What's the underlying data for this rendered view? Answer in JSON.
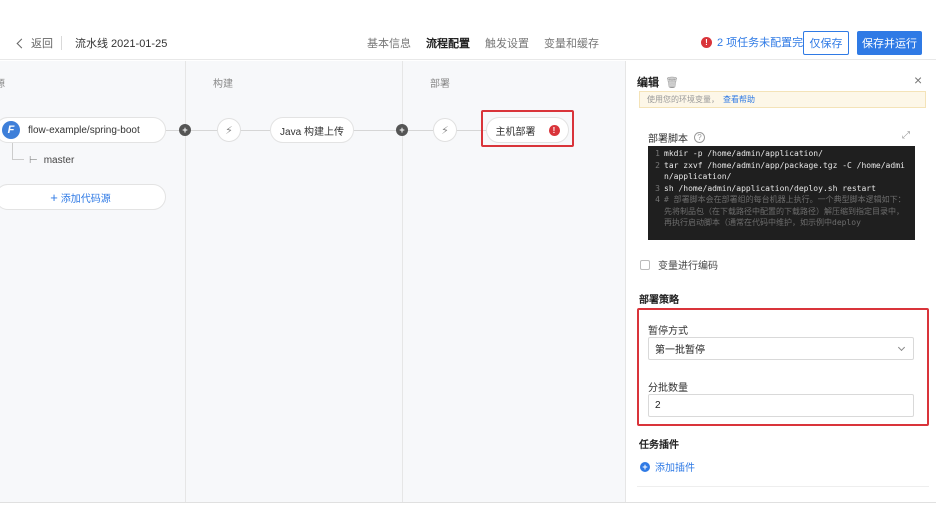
{
  "header": {
    "back_label": "返回",
    "pipeline_name": "流水线 2021-01-25",
    "tabs": [
      {
        "label": "基本信息",
        "active": false
      },
      {
        "label": "流程配置",
        "active": true
      },
      {
        "label": "触发设置",
        "active": false
      },
      {
        "label": "变量和缓存",
        "active": false
      }
    ],
    "warning_badge": "!",
    "warning_text": "2 项任务未配置完",
    "save_label": "仅保存",
    "save_run_label": "保存并运行"
  },
  "canvas": {
    "columns": [
      {
        "label": "源"
      },
      {
        "label": "构建"
      },
      {
        "label": "部署"
      }
    ],
    "source": {
      "icon_letter": "F",
      "repo": "flow-example/spring-boot",
      "branch_symbol": "⊢",
      "branch": "master",
      "add_source_label": "添加代码源"
    },
    "build_job": {
      "label": "Java 构建上传"
    },
    "deploy_job": {
      "label": "主机部署",
      "error_badge": "!"
    }
  },
  "panel": {
    "title": "编辑",
    "tip_text": "使用您的环境变量，",
    "tip_link": "查看帮助",
    "script_label": "部署脚本",
    "script_lines": [
      {
        "n": "1",
        "text": "mkdir -p /home/admin/application/",
        "comment": false
      },
      {
        "n": "2",
        "text": "tar zxvf /home/admin/app/package.tgz -C /home/admin/application/",
        "comment": false
      },
      {
        "n": "3",
        "text": "sh /home/admin/application/deploy.sh restart",
        "comment": false
      },
      {
        "n": "4",
        "text": "# 部署脚本会在部署组的每台机器上执行。一个典型脚本逻辑如下：先将制品包（在下载路径中配置的下载路径）解压缩到指定目录中，再执行启动脚本（通常在代码中维护，如示例中deploy",
        "comment": true
      }
    ],
    "encode_checkbox_label": "变量进行编码",
    "strategy_title": "部署策略",
    "pause_label": "暂停方式",
    "pause_value": "第一批暂停",
    "batch_label": "分批数量",
    "batch_value": "2",
    "plugin_title": "任务插件",
    "add_plugin_label": "添加插件"
  },
  "colors": {
    "accent": "#2f7ae5",
    "error": "#d9343a",
    "code_bg": "#1f1f1f"
  }
}
